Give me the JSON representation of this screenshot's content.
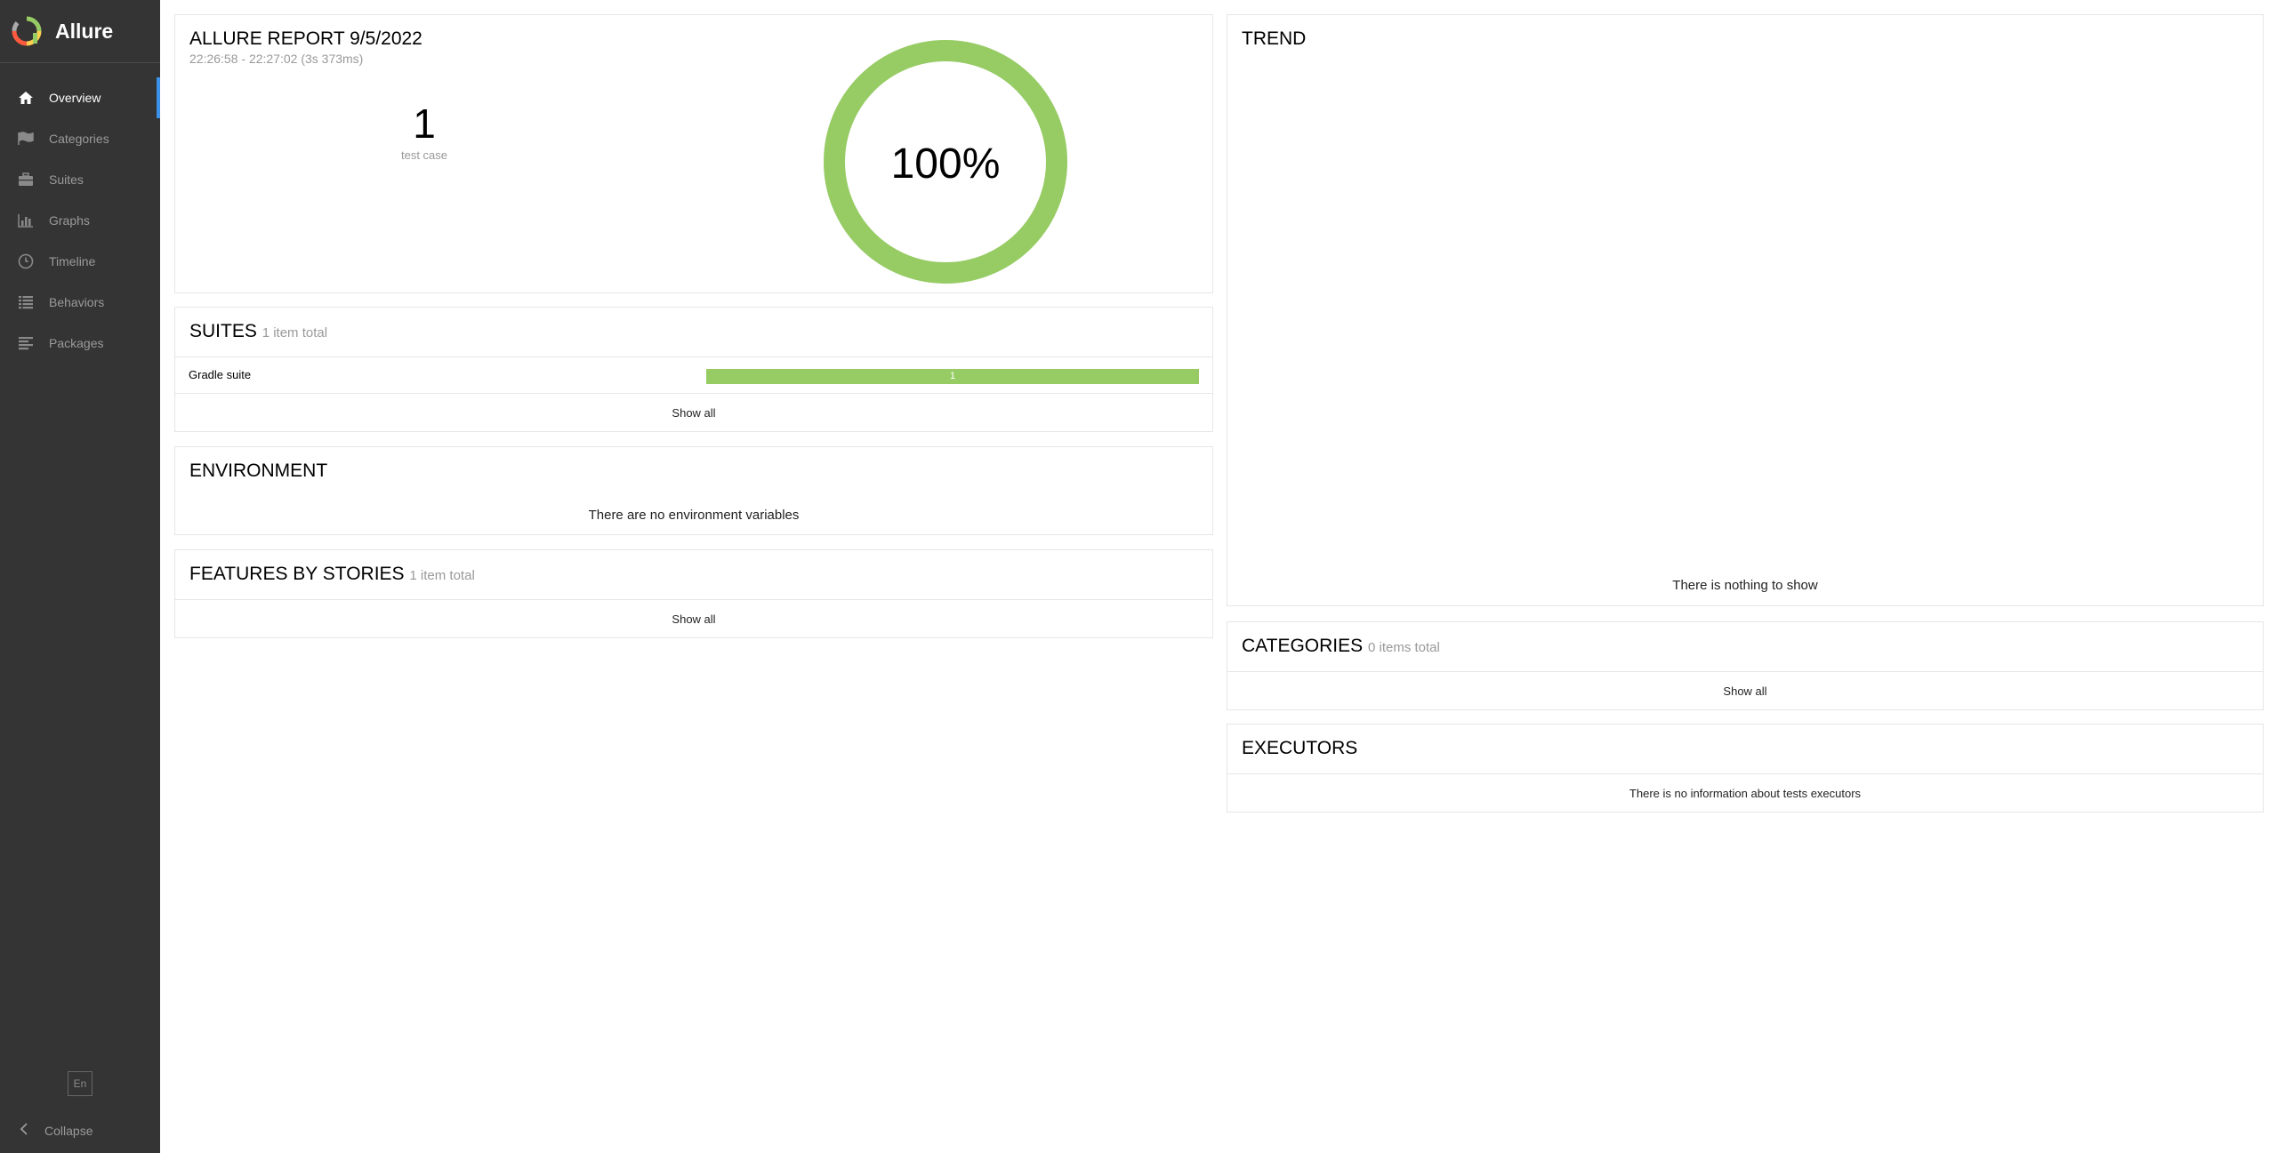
{
  "sidebar": {
    "brand": "Allure",
    "items": [
      {
        "label": "Overview",
        "icon": "home-icon"
      },
      {
        "label": "Categories",
        "icon": "flag-icon"
      },
      {
        "label": "Suites",
        "icon": "briefcase-icon"
      },
      {
        "label": "Graphs",
        "icon": "bar-chart-icon"
      },
      {
        "label": "Timeline",
        "icon": "clock-icon"
      },
      {
        "label": "Behaviors",
        "icon": "list-icon"
      },
      {
        "label": "Packages",
        "icon": "align-left-icon"
      }
    ],
    "language": "En",
    "collapse": "Collapse"
  },
  "summary": {
    "title": "ALLURE REPORT 9/5/2022",
    "time": "22:26:58 - 22:27:02 (3s 373ms)",
    "count": "1",
    "count_label": "test case",
    "percent": "100%",
    "passed_fraction": 1.0
  },
  "suites": {
    "title": "SUITES",
    "sub": "1 item total",
    "rows": [
      {
        "name": "Gradle suite",
        "passed": "1"
      }
    ],
    "show_all": "Show all"
  },
  "environment": {
    "title": "ENVIRONMENT",
    "empty": "There are no environment variables"
  },
  "features": {
    "title": "FEATURES BY STORIES",
    "sub": "1 item total",
    "show_all": "Show all"
  },
  "trend": {
    "title": "TREND",
    "empty": "There is nothing to show"
  },
  "categories": {
    "title": "CATEGORIES",
    "sub": "0 items total",
    "show_all": "Show all"
  },
  "executors": {
    "title": "EXECUTORS",
    "empty": "There is no information about tests executors"
  },
  "colors": {
    "passed": "#97cc64",
    "sidebar": "#343434",
    "accent": "#3b91e8"
  }
}
